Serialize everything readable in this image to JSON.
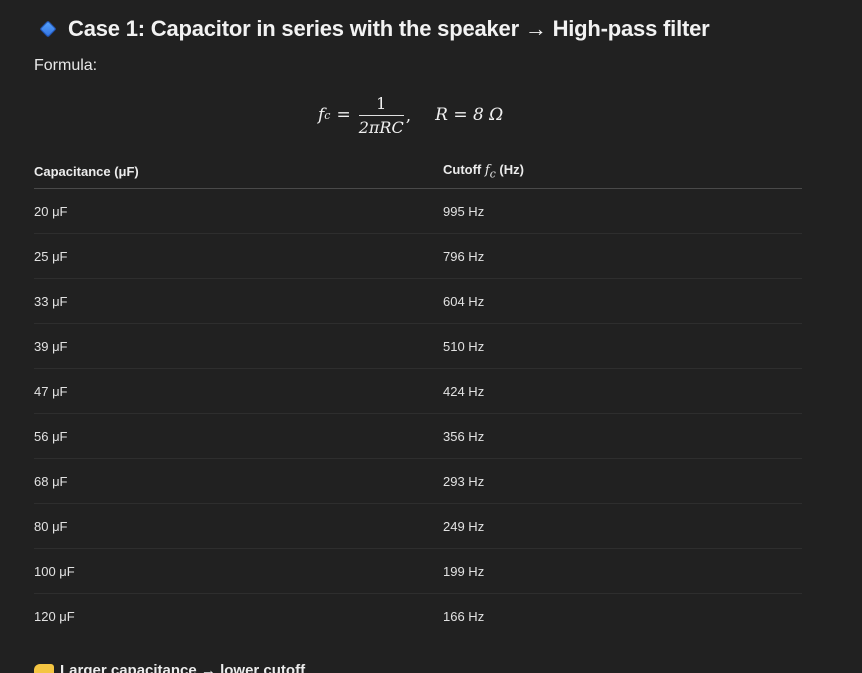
{
  "heading": {
    "icon": "blue-diamond-icon",
    "text": "Case 1: Capacitor in series with the speaker → High-pass filter"
  },
  "formula_label": "Formula:",
  "formula": {
    "lhs_var": "f",
    "lhs_sub": "c",
    "equals": "=",
    "numerator": "1",
    "denominator": "2πRC",
    "comma": ",",
    "resistance": "R = 8 Ω"
  },
  "table": {
    "headers": {
      "capacitance": "Capacitance (μF)",
      "cutoff_prefix": "Cutoff ",
      "cutoff_var": "f",
      "cutoff_sub": "c",
      "cutoff_suffix": " (Hz)"
    },
    "rows": [
      {
        "capacitance": "20 μF",
        "cutoff": "995 Hz"
      },
      {
        "capacitance": "25 μF",
        "cutoff": "796 Hz"
      },
      {
        "capacitance": "33 μF",
        "cutoff": "604 Hz"
      },
      {
        "capacitance": "39 μF",
        "cutoff": "510 Hz"
      },
      {
        "capacitance": "47 μF",
        "cutoff": "424 Hz"
      },
      {
        "capacitance": "56 μF",
        "cutoff": "356 Hz"
      },
      {
        "capacitance": "68 μF",
        "cutoff": "293 Hz"
      },
      {
        "capacitance": "80 μF",
        "cutoff": "249 Hz"
      },
      {
        "capacitance": "100 μF",
        "cutoff": "199 Hz"
      },
      {
        "capacitance": "120 μF",
        "cutoff": "166 Hz"
      }
    ]
  },
  "footer_note": {
    "icon": "pointing-hand-icon",
    "text": "Larger capacitance → lower cutoff"
  },
  "colors": {
    "background": "#212121",
    "text": "#ececec",
    "accent_icon": "#2f6fe0"
  }
}
